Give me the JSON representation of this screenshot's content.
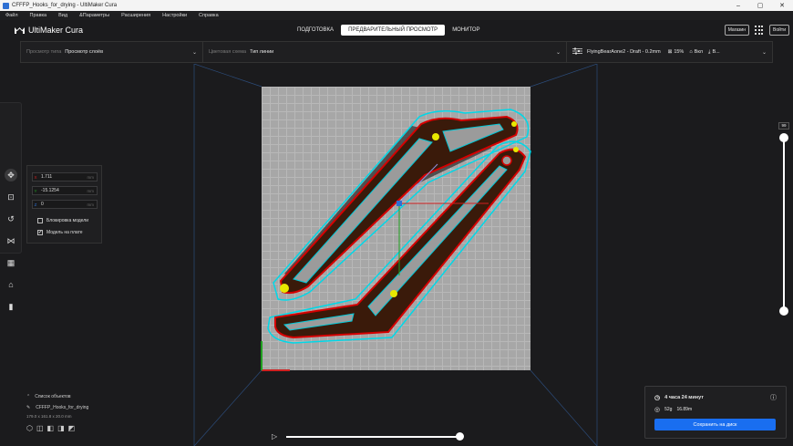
{
  "window": {
    "title": "CFFFP_Hooks_for_drying - UltiMaker Cura",
    "controls": [
      "–",
      "▢",
      "✕"
    ]
  },
  "menu": [
    "Файл",
    "Правка",
    "Вид",
    "&Параметры",
    "Расширения",
    "Настройки",
    "Справка"
  ],
  "header": {
    "logo_text": "UltiMaker Cura",
    "stages": [
      "ПОДГОТОВКА",
      "ПРЕДВАРИТЕЛЬНЫЙ ПРОСМОТР",
      "МОНИТОР"
    ],
    "active_stage": 1,
    "marketplace": "Магазин",
    "signin": "Войти"
  },
  "toolbar": {
    "view_type_label": "Просмотр типа",
    "view_type_value": "Просмотр слоёв",
    "color_scheme_label": "Цветовая схема",
    "color_scheme_value": "Тип линии",
    "printer_profile": "FlyingBearAone2 - Draft - 0.2mm",
    "infill": "15%",
    "support": "Вкл",
    "adhesion": "В..."
  },
  "move_panel": {
    "x": "1.711",
    "y": "-15.1254",
    "z": "0",
    "unit": "mm",
    "lock_model": "Блокировка модели",
    "drop_to_plate": "Модель на плате",
    "drop_to_plate_checked": "✔"
  },
  "objects": {
    "header": "Список объектов",
    "name": "CFFFP_Hooks_for_drying",
    "dims": "179.0 x 161.8 x 20.0 mm"
  },
  "layer_slider": {
    "max_layer": "99",
    "upper_position": 0.0,
    "lower_position": 1.0
  },
  "simulation": {
    "progress": 1.0
  },
  "print_summary": {
    "time": "4 часа 24 минут",
    "weight": "52g",
    "length": "16.89m",
    "save_button": "Сохранить на диск"
  },
  "colors": {
    "accent": "#196ef0",
    "wall_outer": "#d60000",
    "wall_inner": "#3a1a0a",
    "skin": "#e8e800",
    "skirt": "#00d8e8",
    "support": "#404040"
  }
}
